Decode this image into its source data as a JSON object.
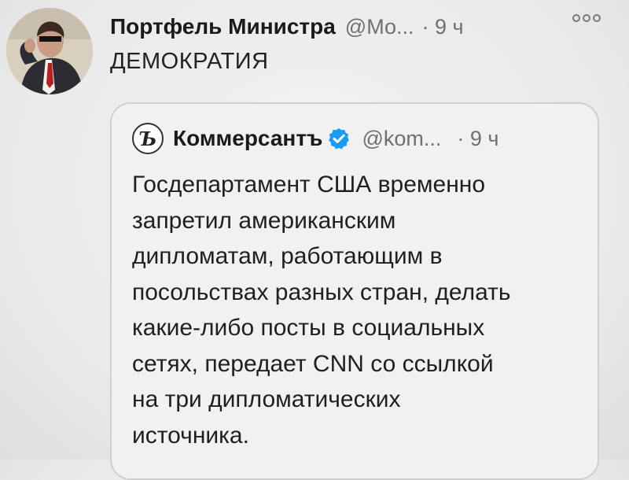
{
  "tweet": {
    "author_name": "Портфель Министра",
    "handle": "@Мо...",
    "time": "· 9 ч",
    "text": "ДЕМОКРАТИЯ",
    "avatar_icon": "person-in-suit-avatar",
    "more_icon": "more-options-icon"
  },
  "quote": {
    "avatar_letter": "Ъ",
    "author_name": "Коммерсантъ",
    "verified_icon": "verified-badge-icon",
    "verified_color": "#1d9bf0",
    "handle": "@kom...",
    "time": "· 9 ч",
    "lines": [
      "Госдепартамент США временно",
      "запретил американским",
      "дипломатам, работающим в",
      "посольствах разных стран, делать",
      "какие-либо посты в социальных",
      "сетях, передает CNN со ссылкой",
      "на три дипломатических",
      "источника."
    ]
  }
}
